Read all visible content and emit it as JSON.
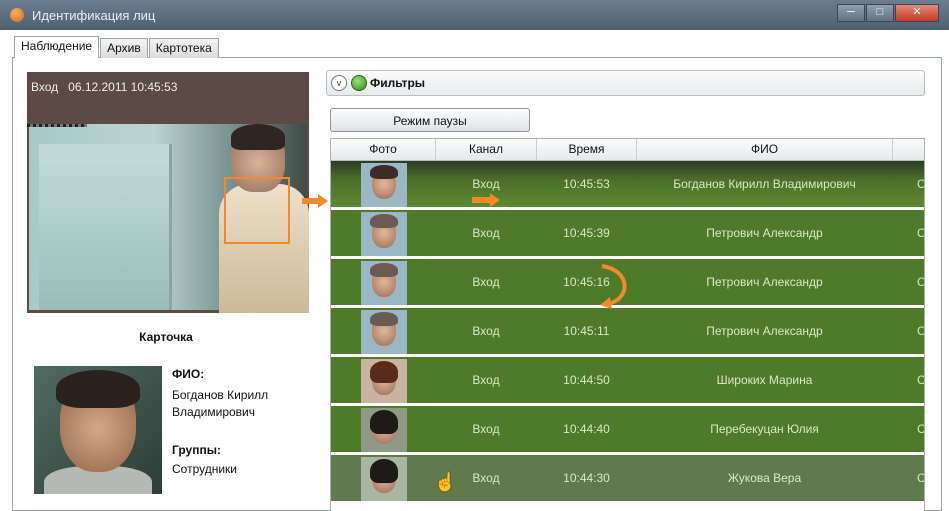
{
  "window": {
    "title": "Идентификация лиц",
    "buttons": [
      "─",
      "□",
      "✕"
    ]
  },
  "tabs": [
    {
      "label": "Наблюдение",
      "active": true
    },
    {
      "label": "Архив",
      "active": false
    },
    {
      "label": "Картотека",
      "active": false
    }
  ],
  "video": {
    "caption": "Вход   06.12.2011 10:45:53"
  },
  "card": {
    "title": "Карточка",
    "fio_label": "ФИО:",
    "fio_value_line1": "Богданов Кирилл",
    "fio_value_line2": "Владимирович",
    "groups_label": "Группы:",
    "groups_value": "Сотрудники"
  },
  "filters": {
    "label": "Фильтры"
  },
  "pause_button": {
    "label": "Режим паузы"
  },
  "table": {
    "columns": [
      "Фото",
      "Канал",
      "Время",
      "ФИО"
    ],
    "rows": [
      {
        "channel": "Вход",
        "time": "10:45:53",
        "name": "Богданов Кирилл Владимирович",
        "edge": "С"
      },
      {
        "channel": "Вход",
        "time": "10:45:39",
        "name": "Петрович Александр",
        "edge": "С"
      },
      {
        "channel": "Вход",
        "time": "10:45:16",
        "name": "Петрович Александр",
        "edge": "С"
      },
      {
        "channel": "Вход",
        "time": "10:45:11",
        "name": "Петрович Александр",
        "edge": "С"
      },
      {
        "channel": "Вход",
        "time": "10:44:50",
        "name": "Широких Марина",
        "edge": "С"
      },
      {
        "channel": "Вход",
        "time": "10:44:40",
        "name": "Перебекуцан Юлия",
        "edge": "С"
      },
      {
        "channel": "Вход",
        "time": "10:44:30",
        "name": "Жукова Вера",
        "edge": "С"
      }
    ]
  },
  "colors": {
    "accent_orange": "#f08a2a",
    "row_green": "#4f7a2a"
  }
}
